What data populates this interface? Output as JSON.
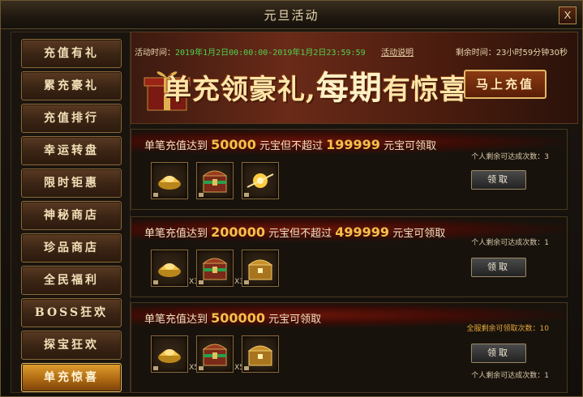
{
  "window": {
    "title": "元旦活动",
    "close_label": "X"
  },
  "sidebar": {
    "items": [
      {
        "label": "充值有礼",
        "active": false
      },
      {
        "label": "累充豪礼",
        "active": false
      },
      {
        "label": "充值排行",
        "active": false
      },
      {
        "label": "幸运转盘",
        "active": false
      },
      {
        "label": "限时钜惠",
        "active": false
      },
      {
        "label": "神秘商店",
        "active": false
      },
      {
        "label": "珍品商店",
        "active": false
      },
      {
        "label": "全民福利",
        "active": false
      },
      {
        "label": "BOSS狂欢",
        "active": false
      },
      {
        "label": "探宝狂欢",
        "active": false
      },
      {
        "label": "单充惊喜",
        "active": true
      }
    ]
  },
  "banner": {
    "time_label": "活动时间：",
    "time_value": "2019年1月2日00:00:00-2019年1月2日23:59:59",
    "rules_link": "活动说明",
    "remain_label": "剩余时间：",
    "remain_value": "23小时59分钟30秒",
    "slogan_a": "单充领豪礼,",
    "slogan_b": "每期",
    "slogan_c": "有惊喜",
    "recharge_button": "马上充值"
  },
  "cards": [
    {
      "prefix": "单笔充值达到",
      "amount1": "50000",
      "mid": "元宝但不超过",
      "amount2": "199999",
      "suffix": "元宝可领取",
      "personal_label": "个人剩余可达成次数：3",
      "server_label": "",
      "claim_button": "领取",
      "items": [
        {
          "icon": "gold-ingot-icon",
          "count": ""
        },
        {
          "icon": "treasure-chest-green-icon",
          "count": ""
        },
        {
          "icon": "golden-orb-icon",
          "count": ""
        }
      ]
    },
    {
      "prefix": "单笔充值达到",
      "amount1": "200000",
      "mid": "元宝但不超过",
      "amount2": "499999",
      "suffix": "元宝可领取",
      "personal_label": "个人剩余可达成次数：1",
      "server_label": "",
      "claim_button": "领取",
      "items": [
        {
          "icon": "gold-ingot-icon",
          "count": "X3"
        },
        {
          "icon": "treasure-chest-green-icon",
          "count": "X3"
        },
        {
          "icon": "golden-chest-icon",
          "count": ""
        }
      ]
    },
    {
      "prefix": "单笔充值达到",
      "amount1": "500000",
      "mid": "元宝可领取",
      "amount2": "",
      "suffix": "",
      "personal_label": "个人剩余可达成次数：1",
      "server_label": "全服剩余可领取次数：10",
      "claim_button": "领取",
      "items": [
        {
          "icon": "gold-ingot-icon",
          "count": "X5"
        },
        {
          "icon": "treasure-chest-green-icon",
          "count": "X5"
        },
        {
          "icon": "golden-chest-icon",
          "count": ""
        }
      ]
    }
  ]
}
